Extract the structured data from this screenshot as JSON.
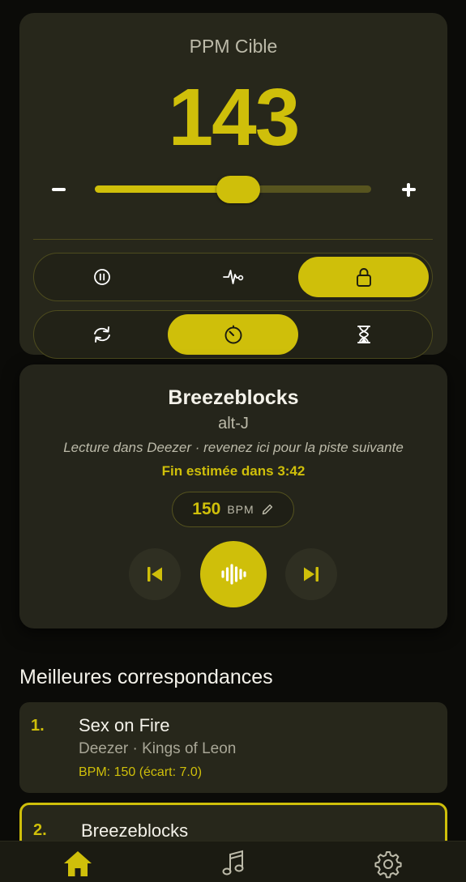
{
  "tempo": {
    "label": "PPM Cible",
    "value": "143",
    "slider_level": 0.52,
    "decrease_icon": "minus-icon",
    "increase_icon": "plus-icon"
  },
  "mode_segment": {
    "options": [
      {
        "icon": "pause-circle-icon",
        "active": false
      },
      {
        "icon": "heartbeat-icon",
        "active": false
      },
      {
        "icon": "lock-icon",
        "active": true
      }
    ]
  },
  "source_segment": {
    "options": [
      {
        "icon": "sync-icon",
        "active": false
      },
      {
        "icon": "timer-icon",
        "active": true
      },
      {
        "icon": "hourglass-icon",
        "active": false
      }
    ]
  },
  "now_playing": {
    "title": "Breezeblocks",
    "artist": "alt-J",
    "hint": "Lecture dans Deezer · revenez ici pour la piste suivante",
    "eta": "Fin estimée dans 3:42",
    "bpm": "150",
    "bpm_unit": "BPM",
    "edit_icon": "pencil-icon"
  },
  "section_title": "Meilleures correspondances",
  "matches": [
    {
      "rank": "1.",
      "title": "Sex on Fire",
      "subtitle": "Deezer · Kings of Leon",
      "bpm_info": "BPM: 150 (écart: 7.0)"
    },
    {
      "rank": "2.",
      "title": "Breezeblocks"
    }
  ],
  "tabs": [
    {
      "icon": "home-icon",
      "active": true
    },
    {
      "icon": "music-note-icon",
      "active": false
    },
    {
      "icon": "gear-icon",
      "active": false
    }
  ],
  "colors": {
    "accent": "#cfbf0a",
    "background": "#0b0b08",
    "card": "#27271b",
    "muted_text": "#bcbaa9"
  }
}
